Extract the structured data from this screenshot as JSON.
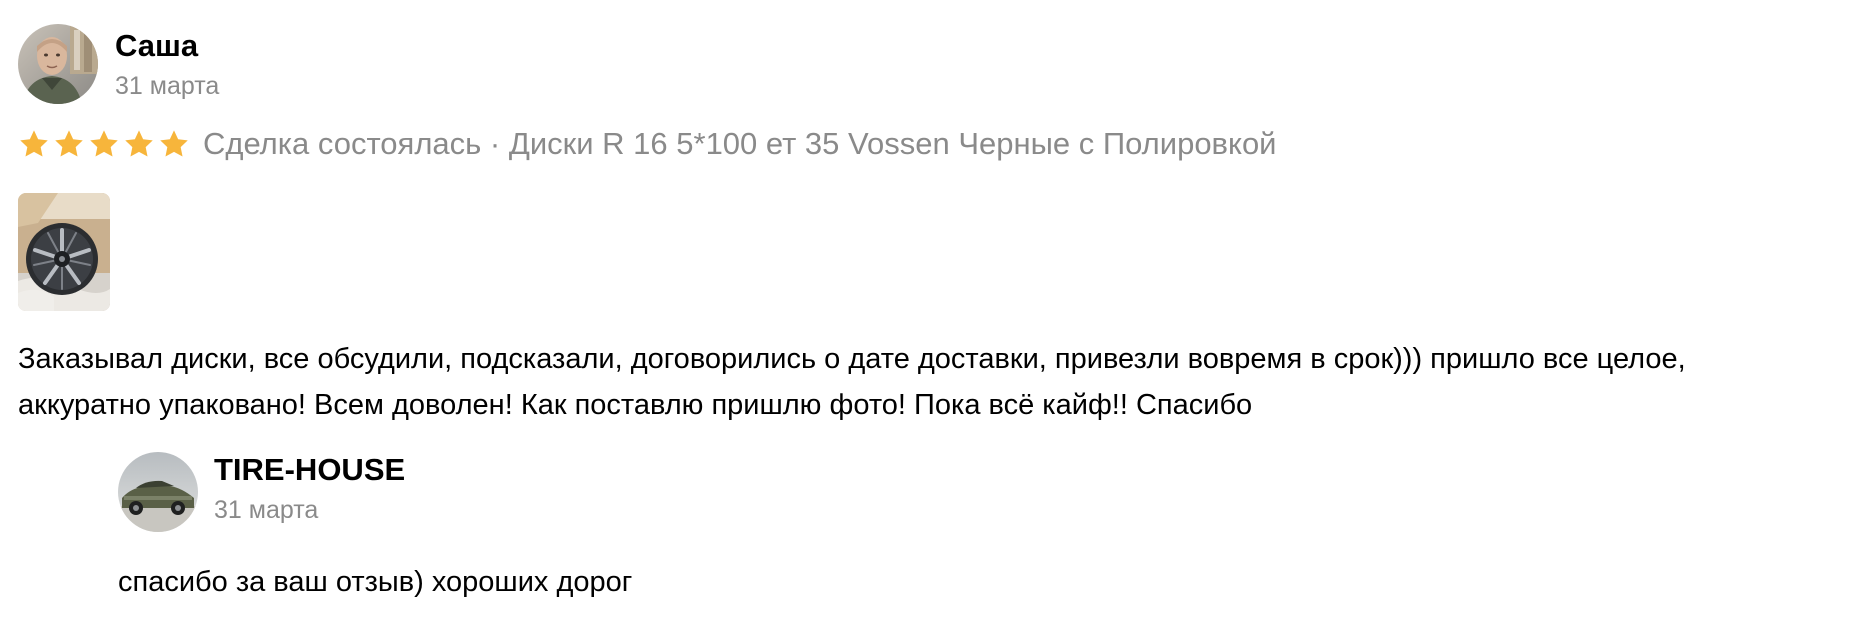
{
  "review": {
    "author": {
      "name": "Саша",
      "date": "31 марта",
      "avatar_icon": "user-avatar-photo"
    },
    "rating": {
      "stars": 5,
      "max_stars": 5,
      "star_color": "#f7b53b",
      "deal_text": "Сделка состоялась · Диски R 16 5*100 ет 35 Vossen Черные с Полировкой"
    },
    "photo": {
      "icon": "wheel-rim-photo"
    },
    "text_lines": [
      "Заказывал диски, все обсудили, подсказали, договорились о дате доставки, привезли вовремя в срок))) пришло все целое,",
      "аккуратно упаковано! Всем доволен! Как поставлю пришлю фото! Пока всё кайф!! Спасибо"
    ]
  },
  "reply": {
    "author": {
      "name": "TIRE-HOUSE",
      "date": "31 марта",
      "avatar_icon": "car-avatar-photo"
    },
    "text": "спасибо за ваш отзыв) хороших дорог"
  },
  "colors": {
    "text": "#000000",
    "muted": "#8a8a8a",
    "star": "#f7b53b",
    "background": "#ffffff"
  }
}
